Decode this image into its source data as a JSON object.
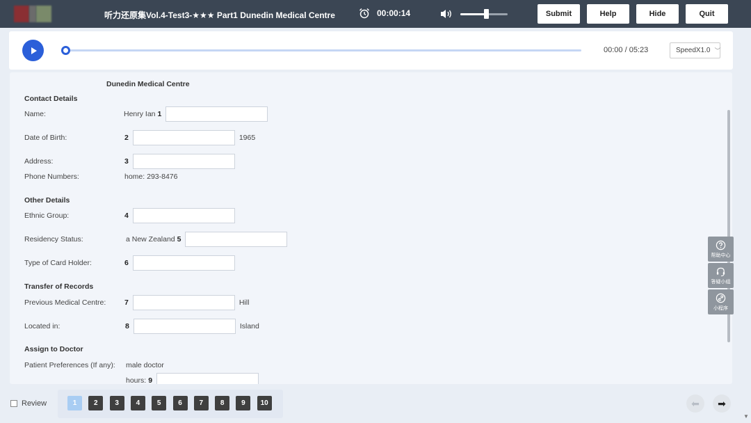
{
  "header": {
    "title": "听力还原集Vol.4-Test3-★★★ Part1 Dunedin Medical Centre",
    "timer": "00:00:14",
    "volume_level": 0.55,
    "buttons": {
      "submit": "Submit",
      "help": "Help",
      "hide": "Hide",
      "quit": "Quit"
    }
  },
  "audio": {
    "time": "00:00 / 05:23",
    "progress": 0,
    "speed": "SpeedX1.0"
  },
  "form": {
    "title": "Dunedin Medical Centre",
    "sections": {
      "contact": "Contact Details",
      "other": "Other Details",
      "transfer": "Transfer of Records",
      "doctor": "Assign to Doctor"
    },
    "rows": {
      "name": {
        "label": "Name:",
        "pre": "Henry Ian",
        "num": "1"
      },
      "dob": {
        "label": "Date of Birth:",
        "num": "2",
        "post": "1965"
      },
      "address": {
        "label": "Address:",
        "num": "3"
      },
      "phone": {
        "label": "Phone Numbers:",
        "value": "home: 293-8476"
      },
      "ethnic": {
        "label": "Ethnic Group:",
        "num": "4"
      },
      "residency": {
        "label": "Residency Status:",
        "pre": "a New Zealand",
        "num": "5"
      },
      "card": {
        "label": "Type of Card Holder:",
        "num": "6"
      },
      "prev_centre": {
        "label": "Previous Medical Centre:",
        "num": "7",
        "post": "Hill"
      },
      "located": {
        "label": "Located in:",
        "num": "8",
        "post": "Island"
      },
      "prefs": {
        "label": "Patient Preferences (If any):",
        "value": "male doctor"
      },
      "hours": {
        "pre": "hours:",
        "num": "9"
      }
    }
  },
  "side": {
    "help_center": "帮助中心",
    "assistant": "答疑小组",
    "mini_program": "小程序"
  },
  "footer": {
    "review": "Review",
    "pages": [
      "1",
      "2",
      "3",
      "4",
      "5",
      "6",
      "7",
      "8",
      "9",
      "10"
    ],
    "active_page": "1",
    "prev_arrow": "⬅",
    "next_arrow": "➡"
  },
  "colors": {
    "header": "#3b4654",
    "accent": "#2b5fd9",
    "active_page": "#a9cdf3"
  }
}
